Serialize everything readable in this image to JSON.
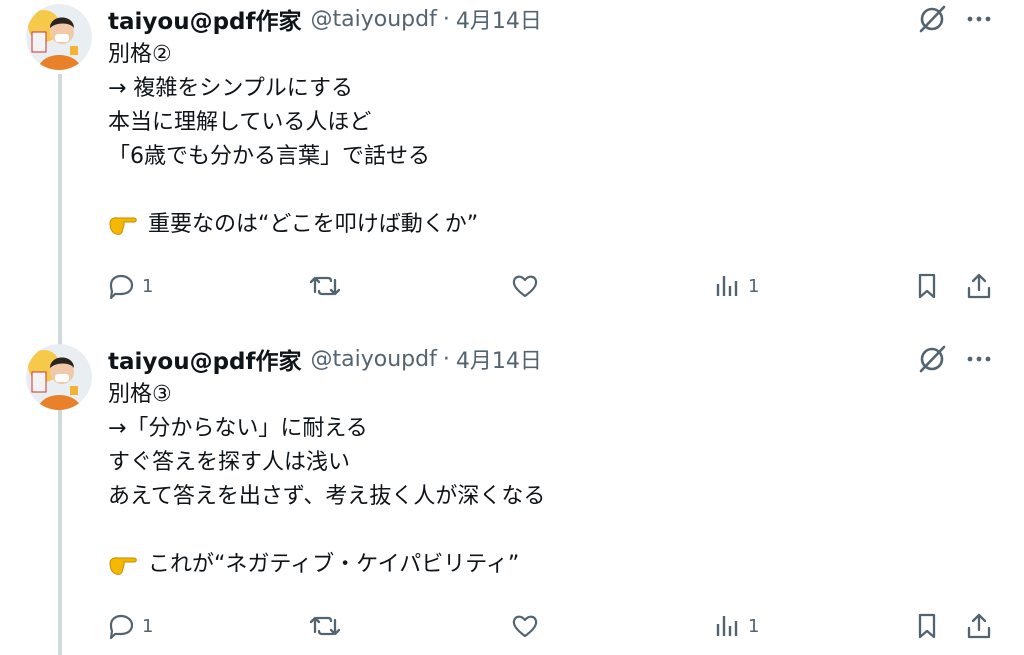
{
  "colors": {
    "text": "#0f1419",
    "muted": "#536471",
    "thread": "#cfd9de",
    "hand": "#f5b800"
  },
  "tweets": [
    {
      "author_name": "taiyou@pdf作家",
      "author_handle": "@taiyoupdf",
      "separator": "·",
      "date": "4月14日",
      "lines": [
        "別格②",
        "→ 複雑をシンプルにする",
        "本当に理解している人ほど",
        "「6歳でも分かる言葉」で話せる",
        "",
        "重要なのは“どこを叩けば動くか”"
      ],
      "last_line_icon": "pointing-hand-emoji",
      "replies": "1",
      "views": "1"
    },
    {
      "author_name": "taiyou@pdf作家",
      "author_handle": "@taiyoupdf",
      "separator": "·",
      "date": "4月14日",
      "lines": [
        "別格③",
        "→「分からない」に耐える",
        "すぐ答えを探す人は浅い",
        "あえて答えを出さず、考え抜く人が深くなる",
        "",
        "これが“ネガティブ・ケイパビリティ”"
      ],
      "last_line_icon": "pointing-hand-emoji",
      "replies": "1",
      "views": "1"
    }
  ]
}
